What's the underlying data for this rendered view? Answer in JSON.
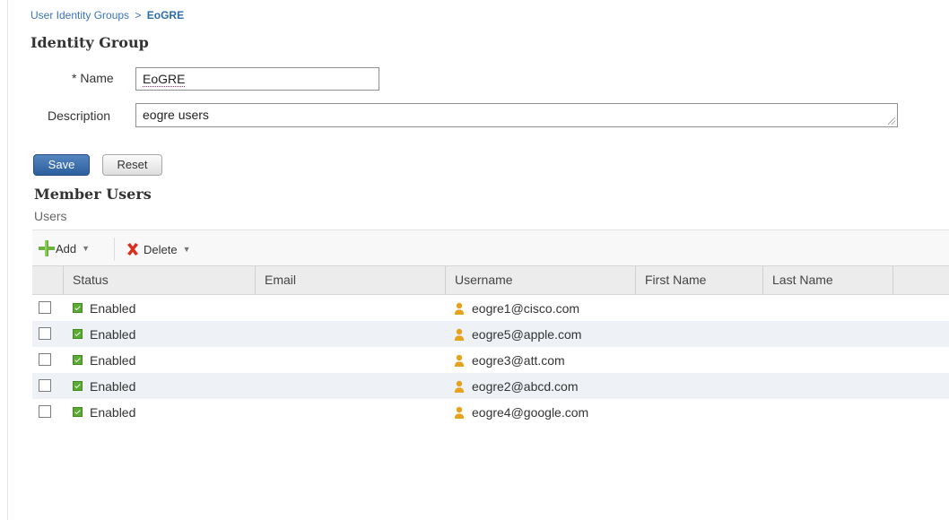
{
  "breadcrumb": {
    "parent": "User Identity Groups",
    "separator": ">",
    "current": "EoGRE"
  },
  "identity_group": {
    "title": "Identity Group",
    "name_label": "* Name",
    "name_value": "EoGRE",
    "description_label": "Description",
    "description_value": "eogre users"
  },
  "buttons": {
    "save": "Save",
    "reset": "Reset"
  },
  "member_users": {
    "title": "Member Users",
    "subtitle": "Users"
  },
  "toolbar": {
    "add": "Add",
    "delete": "Delete",
    "add_icon": "plus-icon",
    "delete_icon": "x-icon"
  },
  "table": {
    "columns": [
      "Status",
      "Email",
      "Username",
      "First Name",
      "Last Name"
    ],
    "rows": [
      {
        "status": "Enabled",
        "email": "",
        "username": "eogre1@cisco.com",
        "first_name": "",
        "last_name": ""
      },
      {
        "status": "Enabled",
        "email": "",
        "username": "eogre5@apple.com",
        "first_name": "",
        "last_name": ""
      },
      {
        "status": "Enabled",
        "email": "",
        "username": "eogre3@att.com",
        "first_name": "",
        "last_name": ""
      },
      {
        "status": "Enabled",
        "email": "",
        "username": "eogre2@abcd.com",
        "first_name": "",
        "last_name": ""
      },
      {
        "status": "Enabled",
        "email": "",
        "username": "eogre4@google.com",
        "first_name": "",
        "last_name": ""
      }
    ]
  },
  "colors": {
    "link": "#3a73b8",
    "save_button": "#2c5f9e",
    "status_enabled": "#5aab32",
    "user_icon": "#e6a21c",
    "row_alt": "#eef1f5"
  }
}
